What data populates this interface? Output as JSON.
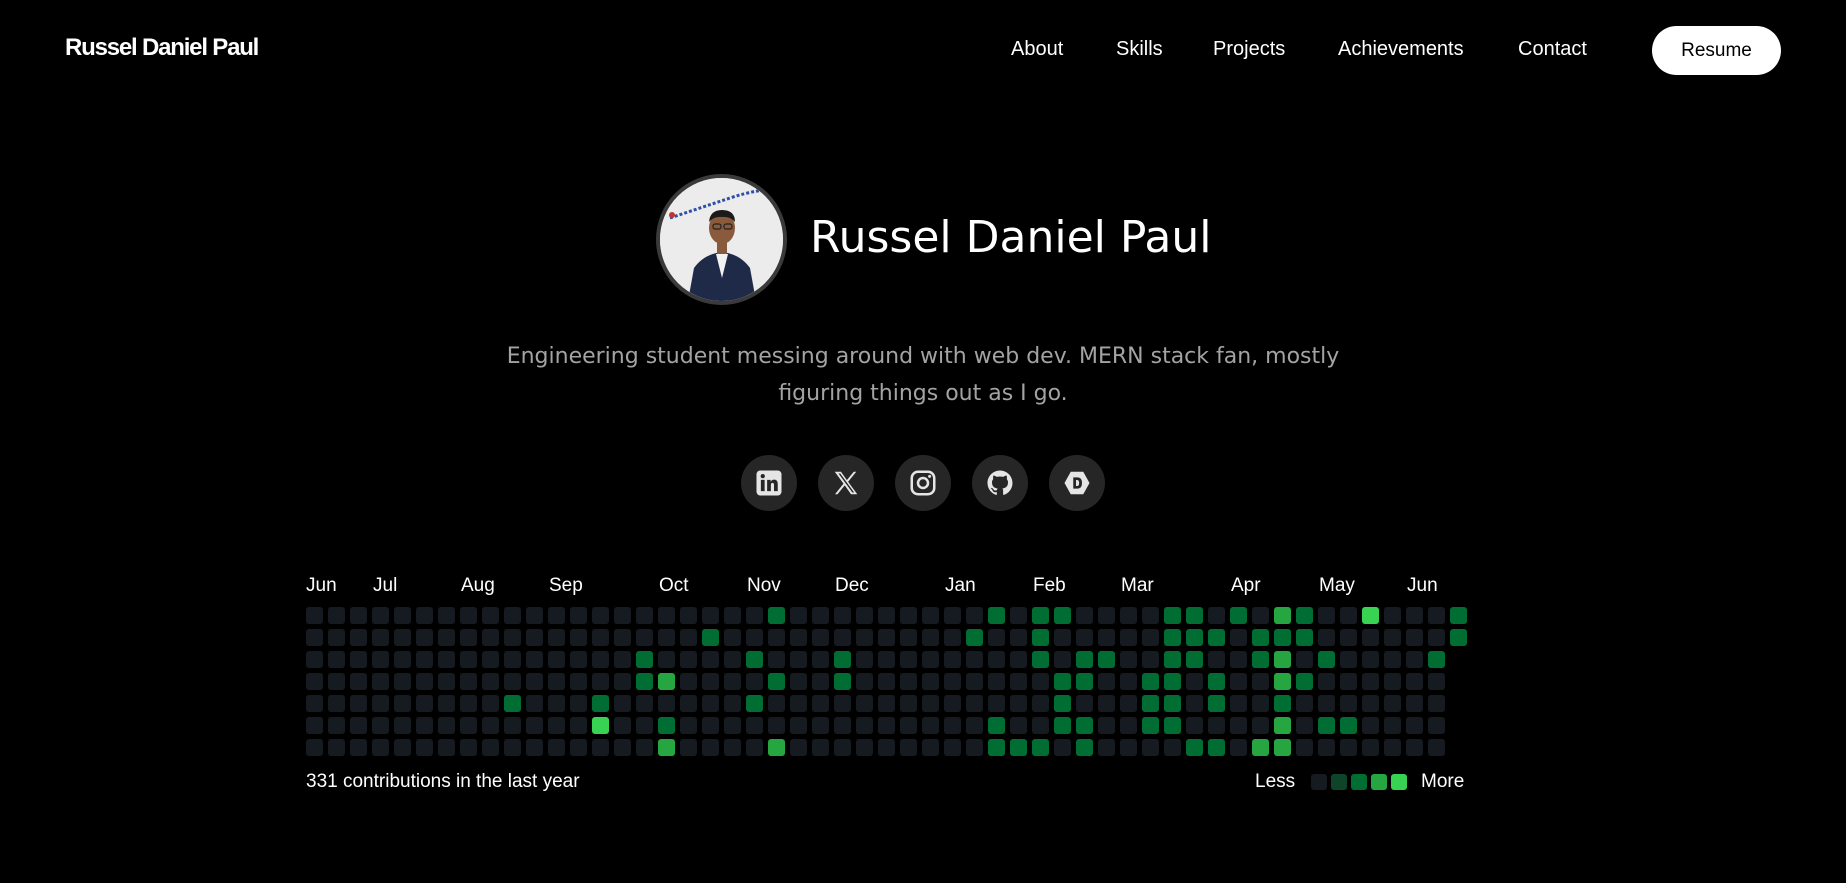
{
  "nav": {
    "brand": "Russel Daniel Paul",
    "links": [
      "About",
      "Skills",
      "Projects",
      "Achievements",
      "Contact"
    ],
    "resume_label": "Resume"
  },
  "hero": {
    "name": "Russel Daniel Paul",
    "bio": "Engineering student messing around with web dev. MERN stack fan, mostly figuring things out as I go."
  },
  "social": [
    {
      "icon": "linkedin-icon"
    },
    {
      "icon": "x-twitter-icon"
    },
    {
      "icon": "instagram-icon"
    },
    {
      "icon": "github-icon"
    },
    {
      "icon": "dev-icon"
    }
  ],
  "contributions": {
    "months": [
      "Jun",
      "Jul",
      "Aug",
      "Sep",
      "Oct",
      "Nov",
      "Dec",
      "Jan",
      "Feb",
      "Mar",
      "Apr",
      "May",
      "Jun"
    ],
    "total_text": "331 contributions in the last year",
    "legend_less": "Less",
    "legend_more": "More",
    "colors": [
      "#161b22",
      "#0e4429",
      "#006d32",
      "#26a641",
      "#39d353"
    ],
    "weeks": [
      [
        0,
        0,
        0,
        0,
        0,
        0,
        0
      ],
      [
        0,
        0,
        0,
        0,
        0,
        0,
        0
      ],
      [
        0,
        0,
        0,
        0,
        0,
        0,
        0
      ],
      [
        0,
        0,
        0,
        0,
        0,
        0,
        0
      ],
      [
        0,
        0,
        0,
        0,
        0,
        0,
        0
      ],
      [
        0,
        0,
        0,
        0,
        0,
        0,
        0
      ],
      [
        0,
        0,
        0,
        0,
        0,
        0,
        0
      ],
      [
        0,
        0,
        0,
        0,
        0,
        0,
        0
      ],
      [
        0,
        0,
        0,
        0,
        0,
        0,
        0
      ],
      [
        0,
        0,
        0,
        0,
        2,
        0,
        0
      ],
      [
        0,
        0,
        0,
        0,
        0,
        0,
        0
      ],
      [
        0,
        0,
        0,
        0,
        0,
        0,
        0
      ],
      [
        0,
        0,
        0,
        0,
        0,
        0,
        0
      ],
      [
        0,
        0,
        0,
        0,
        2,
        4,
        0
      ],
      [
        0,
        0,
        0,
        0,
        0,
        0,
        0
      ],
      [
        0,
        0,
        2,
        2,
        0,
        0,
        0
      ],
      [
        0,
        0,
        0,
        3,
        0,
        2,
        3
      ],
      [
        0,
        0,
        0,
        0,
        0,
        0,
        0
      ],
      [
        0,
        2,
        0,
        0,
        0,
        0,
        0
      ],
      [
        0,
        0,
        0,
        0,
        0,
        0,
        0
      ],
      [
        0,
        0,
        2,
        0,
        2,
        0,
        0
      ],
      [
        2,
        0,
        0,
        2,
        0,
        0,
        3
      ],
      [
        0,
        0,
        0,
        0,
        0,
        0,
        0
      ],
      [
        0,
        0,
        0,
        0,
        0,
        0,
        0
      ],
      [
        0,
        0,
        2,
        2,
        0,
        0,
        0
      ],
      [
        0,
        0,
        0,
        0,
        0,
        0,
        0
      ],
      [
        0,
        0,
        0,
        0,
        0,
        0,
        0
      ],
      [
        0,
        0,
        0,
        0,
        0,
        0,
        0
      ],
      [
        0,
        0,
        0,
        0,
        0,
        0,
        0
      ],
      [
        0,
        0,
        0,
        0,
        0,
        0,
        0
      ],
      [
        0,
        2,
        0,
        0,
        0,
        0,
        0
      ],
      [
        2,
        0,
        0,
        0,
        0,
        2,
        2
      ],
      [
        0,
        0,
        0,
        0,
        0,
        0,
        2
      ],
      [
        2,
        2,
        2,
        0,
        0,
        0,
        2
      ],
      [
        2,
        0,
        0,
        2,
        2,
        2,
        0
      ],
      [
        0,
        0,
        2,
        2,
        0,
        2,
        2
      ],
      [
        0,
        0,
        2,
        0,
        0,
        0,
        0
      ],
      [
        0,
        0,
        0,
        0,
        0,
        0,
        0
      ],
      [
        0,
        0,
        0,
        2,
        2,
        2,
        0
      ],
      [
        2,
        2,
        2,
        2,
        2,
        2,
        0
      ],
      [
        2,
        2,
        2,
        0,
        0,
        0,
        2
      ],
      [
        0,
        2,
        0,
        2,
        2,
        0,
        2
      ],
      [
        2,
        0,
        0,
        0,
        0,
        0,
        0
      ],
      [
        0,
        2,
        2,
        0,
        0,
        0,
        3
      ],
      [
        3,
        2,
        3,
        3,
        2,
        3,
        3
      ],
      [
        2,
        2,
        0,
        2,
        0,
        0,
        0
      ],
      [
        0,
        0,
        2,
        0,
        0,
        2,
        0
      ],
      [
        0,
        0,
        0,
        0,
        0,
        2,
        0
      ],
      [
        4,
        0,
        0,
        0,
        0,
        0,
        0
      ],
      [
        0,
        0,
        0,
        0,
        0,
        0,
        0
      ],
      [
        0,
        0,
        0,
        0,
        0,
        0,
        0
      ],
      [
        0,
        0,
        2,
        0,
        0,
        0,
        0
      ],
      [
        2,
        2
      ]
    ]
  }
}
